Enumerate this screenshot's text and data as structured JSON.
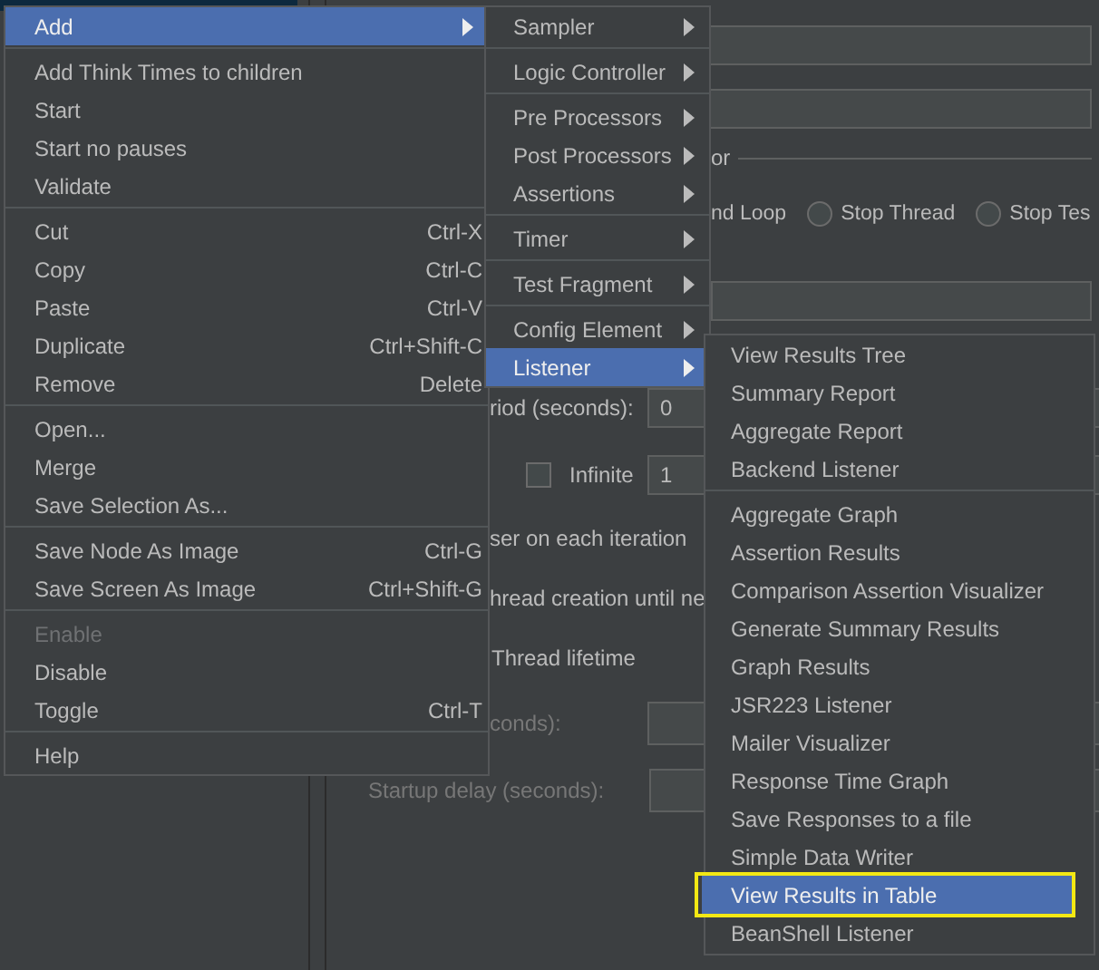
{
  "form": {
    "error_group_title": "or",
    "error_option_fragment": "nd Loop",
    "error_options": [
      {
        "label": "Stop Thread",
        "selected": false
      },
      {
        "label": "Stop Tes",
        "selected": false
      }
    ],
    "ramp_up_label": "riod (seconds):",
    "ramp_up_value": "0",
    "infinite": {
      "label": "Infinite",
      "checked": false
    },
    "loop_value": "1",
    "same_user_label": "ser on each iteration",
    "delay_label": "hread creation until ne",
    "lifetime_label": "Thread lifetime",
    "duration_label": "conds):",
    "startup_delay_label": "Startup delay (seconds):",
    "lifetime_fields_disabled": true
  },
  "context_menu": {
    "groups": [
      [
        {
          "label": "Add",
          "has_submenu": true,
          "selected": true,
          "disabled": false
        }
      ],
      [
        {
          "label": "Add Think Times to children",
          "has_submenu": false,
          "selected": false,
          "disabled": false
        },
        {
          "label": "Start",
          "has_submenu": false,
          "selected": false,
          "disabled": false
        },
        {
          "label": "Start no pauses",
          "has_submenu": false,
          "selected": false,
          "disabled": false
        },
        {
          "label": "Validate",
          "has_submenu": false,
          "selected": false,
          "disabled": false
        }
      ],
      [
        {
          "label": "Cut",
          "shortcut": "Ctrl-X",
          "has_submenu": false,
          "selected": false,
          "disabled": false
        },
        {
          "label": "Copy",
          "shortcut": "Ctrl-C",
          "has_submenu": false,
          "selected": false,
          "disabled": false
        },
        {
          "label": "Paste",
          "shortcut": "Ctrl-V",
          "has_submenu": false,
          "selected": false,
          "disabled": false
        },
        {
          "label": "Duplicate",
          "shortcut": "Ctrl+Shift-C",
          "has_submenu": false,
          "selected": false,
          "disabled": false
        },
        {
          "label": "Remove",
          "shortcut": "Delete",
          "has_submenu": false,
          "selected": false,
          "disabled": false
        }
      ],
      [
        {
          "label": "Open...",
          "has_submenu": false,
          "selected": false,
          "disabled": false
        },
        {
          "label": "Merge",
          "has_submenu": false,
          "selected": false,
          "disabled": false
        },
        {
          "label": "Save Selection As...",
          "has_submenu": false,
          "selected": false,
          "disabled": false
        }
      ],
      [
        {
          "label": "Save Node As Image",
          "shortcut": "Ctrl-G",
          "has_submenu": false,
          "selected": false,
          "disabled": false
        },
        {
          "label": "Save Screen As Image",
          "shortcut": "Ctrl+Shift-G",
          "has_submenu": false,
          "selected": false,
          "disabled": false
        }
      ],
      [
        {
          "label": "Enable",
          "has_submenu": false,
          "selected": false,
          "disabled": true
        },
        {
          "label": "Disable",
          "has_submenu": false,
          "selected": false,
          "disabled": false
        },
        {
          "label": "Toggle",
          "shortcut": "Ctrl-T",
          "has_submenu": false,
          "selected": false,
          "disabled": false
        }
      ],
      [
        {
          "label": "Help",
          "has_submenu": false,
          "selected": false,
          "disabled": false
        }
      ]
    ]
  },
  "add_submenu": {
    "groups": [
      [
        {
          "label": "Sampler",
          "has_submenu": true,
          "selected": false
        }
      ],
      [
        {
          "label": "Logic Controller",
          "has_submenu": true,
          "selected": false
        }
      ],
      [
        {
          "label": "Pre Processors",
          "has_submenu": true,
          "selected": false
        },
        {
          "label": "Post Processors",
          "has_submenu": true,
          "selected": false
        },
        {
          "label": "Assertions",
          "has_submenu": true,
          "selected": false
        }
      ],
      [
        {
          "label": "Timer",
          "has_submenu": true,
          "selected": false
        }
      ],
      [
        {
          "label": "Test Fragment",
          "has_submenu": true,
          "selected": false
        }
      ],
      [
        {
          "label": "Config Element",
          "has_submenu": true,
          "selected": false
        },
        {
          "label": "Listener",
          "has_submenu": true,
          "selected": true
        }
      ]
    ]
  },
  "listener_submenu": {
    "groups": [
      [
        {
          "label": "View Results Tree",
          "selected": false,
          "outlined": false
        },
        {
          "label": "Summary Report",
          "selected": false,
          "outlined": false
        },
        {
          "label": "Aggregate Report",
          "selected": false,
          "outlined": false
        },
        {
          "label": "Backend Listener",
          "selected": false,
          "outlined": false
        }
      ],
      [
        {
          "label": "Aggregate Graph",
          "selected": false,
          "outlined": false
        },
        {
          "label": "Assertion Results",
          "selected": false,
          "outlined": false
        },
        {
          "label": "Comparison Assertion Visualizer",
          "selected": false,
          "outlined": false
        },
        {
          "label": "Generate Summary Results",
          "selected": false,
          "outlined": false
        },
        {
          "label": "Graph Results",
          "selected": false,
          "outlined": false
        },
        {
          "label": "JSR223 Listener",
          "selected": false,
          "outlined": false
        },
        {
          "label": "Mailer Visualizer",
          "selected": false,
          "outlined": false
        },
        {
          "label": "Response Time Graph",
          "selected": false,
          "outlined": false
        },
        {
          "label": "Save Responses to a file",
          "selected": false,
          "outlined": false
        },
        {
          "label": "Simple Data Writer",
          "selected": false,
          "outlined": false
        },
        {
          "label": "View Results in Table",
          "selected": true,
          "outlined": true
        },
        {
          "label": "BeanShell Listener",
          "selected": false,
          "outlined": false
        }
      ]
    ]
  }
}
